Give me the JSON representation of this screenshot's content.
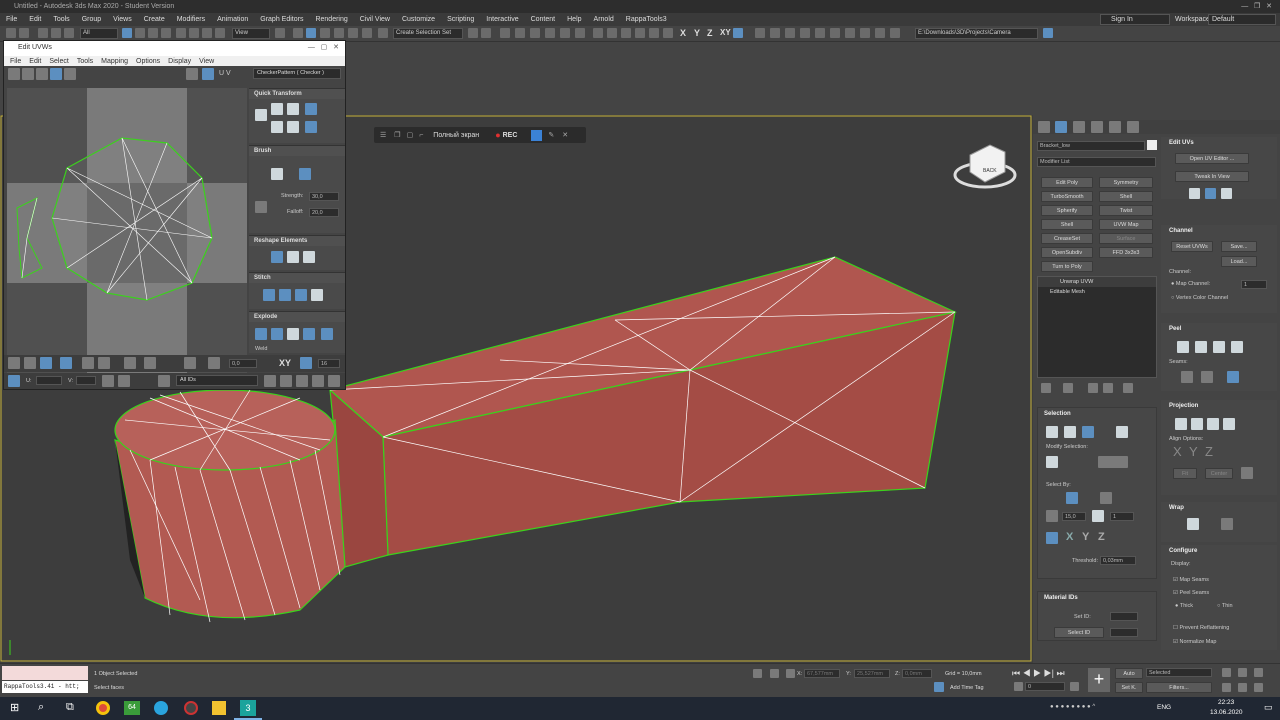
{
  "window": {
    "title": "Untitled - Autodesk 3ds Max 2020 - Student Version",
    "signin": "Sign In",
    "workspaces_label": "Workspaces:",
    "workspace_value": "Default"
  },
  "menu": [
    "File",
    "Edit",
    "Tools",
    "Group",
    "Views",
    "Create",
    "Modifiers",
    "Animation",
    "Graph Editors",
    "Rendering",
    "Civil View",
    "Customize",
    "Scripting",
    "Interactive",
    "Content",
    "Help",
    "Arnold",
    "RappaTools3"
  ],
  "toolbar": {
    "filter": "All",
    "view": "View",
    "selection_set": "Create Selection Set",
    "path": "E:\\Downloads\\3D\\Projects\\Camera",
    "axes": [
      "X",
      "Y",
      "Z",
      "XY"
    ]
  },
  "uv_editor": {
    "title": "Edit UVWs",
    "menu": [
      "File",
      "Edit",
      "Select",
      "Tools",
      "Mapping",
      "Options",
      "Display",
      "View"
    ],
    "uv_label": "U V",
    "pattern": "CheckerPattern  ( Checker )",
    "rollouts": {
      "quick_transform": "Quick Transform",
      "brush": "Brush",
      "strength_label": "Strength:",
      "strength": "30,0",
      "falloff_label": "Falloff:",
      "falloff": "20,0",
      "reshape": "Reshape Elements",
      "stitch": "Stitch",
      "explode": "Explode",
      "weld": "Weld"
    },
    "bottom": {
      "value": "0,0",
      "xy": "XY",
      "count": "16",
      "u_label": "U:",
      "v_label": "V:",
      "ids": "All IDs"
    }
  },
  "rec_bar": {
    "fullscreen": "Полный экран",
    "rec": "REC"
  },
  "command_panel": {
    "object_name": "Bracket_low",
    "modifier_list": "Modifier List",
    "modifier_buttons": [
      "Edit Poly",
      "Symmetry",
      "TurboSmooth",
      "Shell",
      "Spherify",
      "Twist",
      "Shell",
      "UVW Map",
      "CreaseSet",
      "Surface",
      "OpenSubdiv",
      "FFD 3x3x3",
      "Turn to Poly"
    ],
    "stack": [
      "Unwrap UVW",
      "Editable Mesh"
    ],
    "selection": {
      "title": "Selection",
      "modify_selection": "Modify Selection:",
      "select_by": "Select By:",
      "angle": "15,0",
      "count": "1",
      "threshold_label": "Threshold:",
      "threshold": "0,03mm"
    },
    "material_ids": {
      "title": "Material IDs",
      "set_id": "Set ID:",
      "select_id": "Select ID"
    }
  },
  "edit_uvs_panel": {
    "title": "Edit UVs",
    "open_editor": "Open UV Editor ...",
    "tweak": "Tweak In View",
    "channel": {
      "title": "Channel",
      "reset": "Reset UVWs",
      "save": "Save...",
      "load": "Load...",
      "map_channel_label": "Channel:",
      "map_channel": "Map Channel:",
      "map_channel_value": "1",
      "vertex_color": "Vertex Color Channel"
    },
    "peel": {
      "title": "Peel",
      "seams": "Seams:"
    },
    "projection": {
      "title": "Projection",
      "align_options": "Align Options:",
      "axes": [
        "X",
        "Y",
        "Z"
      ],
      "fit": "Fit",
      "center": "Center"
    },
    "wrap": {
      "title": "Wrap"
    },
    "configure": {
      "title": "Configure",
      "display": "Display:",
      "map_seams": "Map Seams",
      "peel_seams": "Peel Seams",
      "thick": "Thick",
      "thin": "Thin",
      "prevent": "Prevent Reflattening",
      "normalize": "Normalize Map"
    }
  },
  "status": {
    "selected": "1 Object Selected",
    "prompt": "Select faces",
    "script": "RappaTools3.41 - htt;",
    "x_label": "X:",
    "x": "67,577mm",
    "y_label": "Y:",
    "y": "25,527mm",
    "z_label": "Z:",
    "z": "0,0mm",
    "grid": "Grid = 10,0mm",
    "add_time_tag": "Add Time Tag",
    "auto": "Auto",
    "selected_dd": "Selected",
    "setk": "Set K.",
    "filters": "Filters...",
    "frame": "0"
  },
  "taskbar": {
    "lang": "ENG",
    "time": "22:23",
    "date": "13.06.2020",
    "badge": "64"
  },
  "colors": {
    "mesh": "#b0564f",
    "wire": "#ffffff",
    "edge": "#3bd21c",
    "accent": "#5c8fc0"
  }
}
